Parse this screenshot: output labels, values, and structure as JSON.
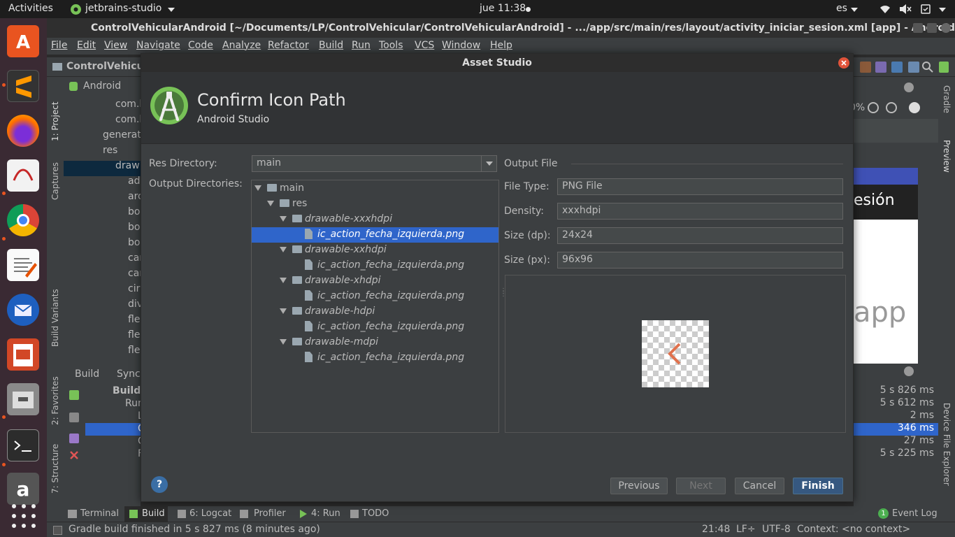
{
  "topbar": {
    "activities": "Activities",
    "app_name": "jetbrains-studio",
    "clock": "jue 11:38",
    "language": "es"
  },
  "ide": {
    "window_title": "ControlVehicularAndroid [~/Documents/LP/ControlVehicular/ControlVehicularAndroid] - .../app/src/main/res/layout/activity_iniciar_sesion.xml [app] - Android Studio",
    "menu": [
      "File",
      "Edit",
      "View",
      "Navigate",
      "Code",
      "Analyze",
      "Refactor",
      "Build",
      "Run",
      "Tools",
      "VCS",
      "Window",
      "Help"
    ],
    "breadcrumb": "ControlVehicul",
    "project_view": "Android",
    "project_tree": [
      "com.h",
      "com.h",
      "generat",
      "res",
      "draw",
      "ad",
      "arc",
      "bo",
      "bo",
      "bo",
      "car",
      "car",
      "cir",
      "div",
      "fle",
      "fle",
      "fle"
    ],
    "left_tabs": {
      "project": "1: Project",
      "captures": "Captures",
      "build_variants": "Build Variants",
      "favorites": "2: Favorites",
      "structure": "7: Structure"
    },
    "right_tabs": {
      "gradle": "Gradle",
      "preview": "Preview",
      "device_explorer": "Device File Explorer"
    },
    "build_tabs": [
      "Build",
      "Sync"
    ],
    "build_tree": [
      "Build:",
      "Run",
      "L",
      "C",
      "C",
      "F"
    ],
    "build_times": [
      "5 s 826 ms",
      "5 s 612 ms",
      "2 ms",
      "346 ms",
      "27 ms",
      "5 s 225 ms"
    ],
    "preview_text": {
      "zoom": "0%",
      "sesion": "esión",
      "app": "app"
    },
    "bottom_tabs": [
      {
        "label": "Terminal",
        "icon": "terminal-icon"
      },
      {
        "label": "Build",
        "icon": "build-icon"
      },
      {
        "label": "6: Logcat",
        "icon": "logcat-icon"
      },
      {
        "label": "Profiler",
        "icon": "profiler-icon"
      },
      {
        "label": "4: Run",
        "icon": "run-icon"
      },
      {
        "label": "TODO",
        "icon": "todo-icon"
      }
    ],
    "event_log": "Event Log",
    "event_badge": "1",
    "status_message": "Gradle build finished in 5 s 827 ms (8 minutes ago)",
    "status_position": "21:48",
    "status_lf": "LF÷",
    "status_encoding": "UTF-8",
    "status_context": "Context: <no context>"
  },
  "dialog": {
    "title": "Asset Studio",
    "header_title": "Confirm Icon Path",
    "header_subtitle": "Android Studio",
    "res_directory_label": "Res Directory:",
    "res_directory_value": "main",
    "output_dirs_label": "Output Directories:",
    "tree": [
      {
        "text": "main",
        "type": "folder",
        "level": 0,
        "italic": false,
        "selected": false
      },
      {
        "text": "res",
        "type": "folder",
        "level": 1,
        "italic": false,
        "selected": false
      },
      {
        "text": "drawable-xxxhdpi",
        "type": "folder",
        "level": 2,
        "italic": true,
        "selected": false
      },
      {
        "text": "ic_action_fecha_izquierda.png",
        "type": "file",
        "level": 3,
        "italic": true,
        "selected": true
      },
      {
        "text": "drawable-xxhdpi",
        "type": "folder",
        "level": 2,
        "italic": true,
        "selected": false
      },
      {
        "text": "ic_action_fecha_izquierda.png",
        "type": "file",
        "level": 3,
        "italic": true,
        "selected": false
      },
      {
        "text": "drawable-xhdpi",
        "type": "folder",
        "level": 2,
        "italic": true,
        "selected": false
      },
      {
        "text": "ic_action_fecha_izquierda.png",
        "type": "file",
        "level": 3,
        "italic": true,
        "selected": false
      },
      {
        "text": "drawable-hdpi",
        "type": "folder",
        "level": 2,
        "italic": true,
        "selected": false
      },
      {
        "text": "ic_action_fecha_izquierda.png",
        "type": "file",
        "level": 3,
        "italic": true,
        "selected": false
      },
      {
        "text": "drawable-mdpi",
        "type": "folder",
        "level": 2,
        "italic": true,
        "selected": false
      },
      {
        "text": "ic_action_fecha_izquierda.png",
        "type": "file",
        "level": 3,
        "italic": true,
        "selected": false
      }
    ],
    "output_file_label": "Output File",
    "file_type_label": "File Type:",
    "file_type_value": "PNG File",
    "density_label": "Density:",
    "density_value": "xxxhdpi",
    "size_dp_label": "Size (dp):",
    "size_dp_value": "24x24",
    "size_px_label": "Size (px):",
    "size_px_value": "96x96",
    "buttons": {
      "help": "?",
      "previous": "Previous",
      "next": "Next",
      "cancel": "Cancel",
      "finish": "Finish"
    }
  },
  "colors": {
    "selection": "#2f65ca",
    "accent": "#e95420",
    "preview_icon": "#e0714d",
    "android_green": "#78c257"
  }
}
